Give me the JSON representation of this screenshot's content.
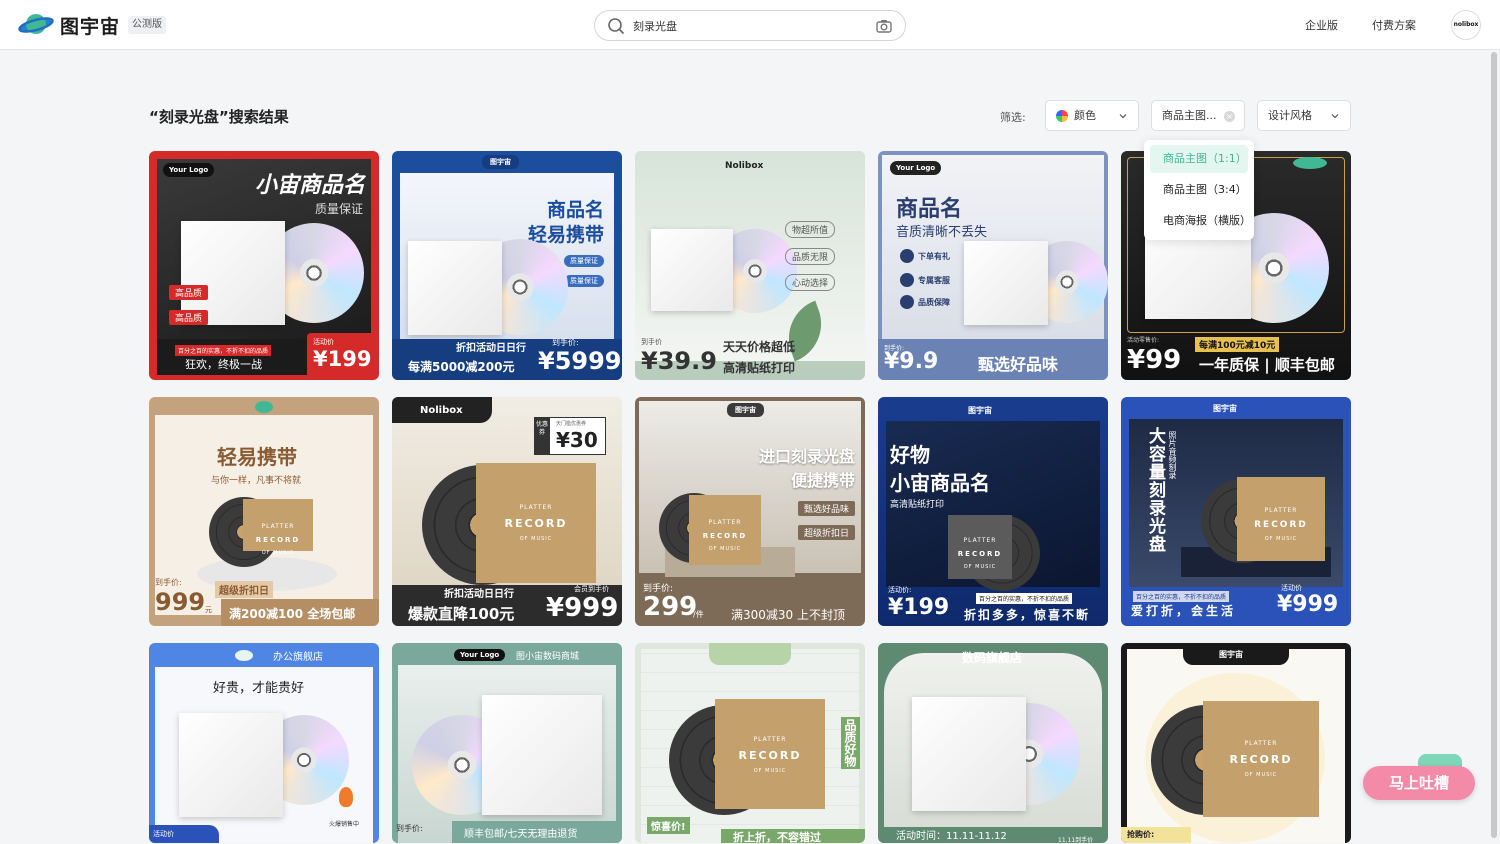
{
  "header": {
    "brand": "图宇宙",
    "beta_badge": "公测版",
    "search_value": "刻录光盘",
    "nav_links": [
      "企业版",
      "付费方案"
    ],
    "avatar_text": "nolibox"
  },
  "results": {
    "title": "“刻录光盘”搜索结果",
    "filter_label": "筛选:",
    "filters": {
      "color": "颜色",
      "type": "商品主图...",
      "style": "设计风格"
    },
    "type_dropdown": {
      "options": [
        "商品主图（1:1）",
        "商品主图（3:4）",
        "电商海报（横版）"
      ],
      "selected": "商品主图（1:1）"
    }
  },
  "cards": [
    {
      "title": "小宙商品名",
      "subtitle": "质量保证",
      "tags": [
        "高品质",
        "高品质"
      ],
      "price_label": "活动价",
      "price": "¥199",
      "promo": "狂欢，终极一战",
      "brand": "Your Logo",
      "fine": "百分之百的实惠，不折不扣的品质"
    },
    {
      "title": "商品名",
      "subtitle": "轻易携带",
      "tags": [
        "质量保证",
        "质量保证"
      ],
      "price_label": "到手价:",
      "price": "¥5999",
      "promo": "每满5000减200元",
      "brand": "图宇宙",
      "fine": "折扣活动日日行"
    },
    {
      "title": "",
      "subtitle": "",
      "tags": [
        "物超所值",
        "品质无限",
        "心动选择"
      ],
      "price_label": "到手价",
      "price": "¥39.9",
      "promo": "天天价格超低",
      "brand": "Nolibox",
      "fine": "高清贴纸打印"
    },
    {
      "title": "商品名",
      "subtitle": "音质清晰不丢失",
      "tags": [
        "下单有礼",
        "专属客服",
        "品质保障"
      ],
      "price_label": "到手价:",
      "price": "¥9.9",
      "promo": "甄选好品味",
      "brand": "Your Logo",
      "fine": ""
    },
    {
      "title": "",
      "subtitle": "",
      "tags": [],
      "price_label": "活动零售价:",
      "price": "¥99",
      "promo": "一年质保 | 顺丰包邮",
      "brand": "",
      "fine": "每满100元减10元"
    },
    {
      "title": "轻易携带",
      "subtitle": "与你一样，凡事不将就",
      "tags": [],
      "price_label": "到手价:",
      "price": "999",
      "price_unit": "元",
      "promo": "满200减100 全场包邮",
      "brand": "",
      "fine": "超级折扣日"
    },
    {
      "title": "",
      "subtitle": "",
      "tags": [],
      "price_label": "会员到手价",
      "price": "¥999",
      "promo": "爆款直降100元",
      "brand": "Nolibox",
      "fine": "折扣活动日日行",
      "coupon_label": "优惠券",
      "coupon_note": "天门槛优惠券",
      "coupon_value": "¥30"
    },
    {
      "title": "进口刻录光盘",
      "subtitle": "便捷携带",
      "tags": [
        "甄选好品味",
        "超级折扣日"
      ],
      "price_label": "到手价:",
      "price": "299",
      "price_unit": "/件",
      "promo": "满300减30 上不封顶",
      "brand": "图宇宙",
      "fine": ""
    },
    {
      "title": "小宙商品名",
      "subtitle": "好物",
      "tags": [],
      "price_label": "活动价:",
      "price": "¥199",
      "promo": "折扣多多，惊喜不断",
      "brand": "图宇宙",
      "fine": "高清贴纸打印",
      "fine2": "百分之百的实惠，不折不扣的品质"
    },
    {
      "title": "大容量刻录光盘",
      "subtitle": "照片音频刻录",
      "tags": [],
      "price_label": "活动价",
      "price": "¥999",
      "promo": "爱打折，会生活",
      "brand": "图宇宙",
      "fine": "百分之百的实惠，不折不扣的品质"
    },
    {
      "title": "好贵，才能贵好",
      "subtitle": "办公旗舰店",
      "tags": [],
      "price_label": "活动价",
      "price": "",
      "promo": "",
      "brand": "",
      "fine": "火爆销售中"
    },
    {
      "title": "",
      "subtitle": "图小宙数码商城",
      "tags": [],
      "price_label": "到手价:",
      "price": "",
      "promo": "顺丰包邮/七天无理由退货",
      "brand": "Your Logo",
      "fine": ""
    },
    {
      "title": "品质好物",
      "subtitle": "",
      "tags": [],
      "price_label": "惊喜价!",
      "price": "",
      "promo": "折上折，不容错过",
      "brand": "",
      "fine": ""
    },
    {
      "title": "数码旗舰店",
      "subtitle": "",
      "tags": [],
      "price_label": "",
      "price": "",
      "promo": "活动时间：11.11-11.12",
      "brand": "",
      "fine": "11.11到手价"
    },
    {
      "title": "",
      "subtitle": "",
      "tags": [],
      "price_label": "抢购价:",
      "price": "",
      "promo": "",
      "brand": "图宇宙",
      "fine": ""
    }
  ],
  "record_text": {
    "line1": "PLATTER",
    "line2": "RECORD",
    "line3": "OF MUSIC"
  },
  "floating": {
    "feedback": "马上吐槽"
  },
  "colors": {
    "accent_green": "#3fb592",
    "page_bg": "#f4f5f7",
    "feedback_pink": "#f28aa8"
  }
}
